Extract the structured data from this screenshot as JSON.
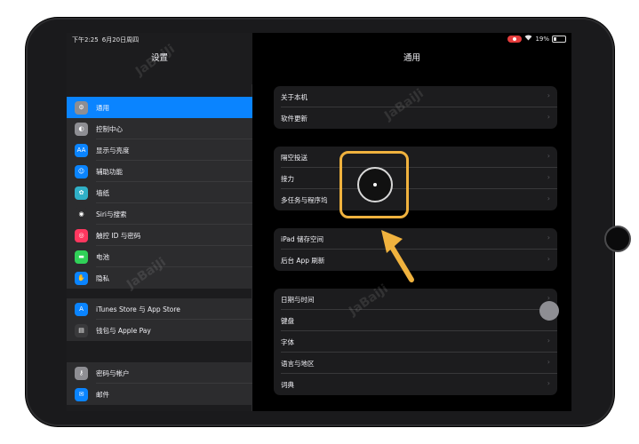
{
  "status_bar": {
    "time": "下午2:25",
    "date": "6月20日周四",
    "battery": "19%"
  },
  "sidebar": {
    "title": "设置",
    "groups": [
      {
        "items": [
          {
            "label": "通用",
            "icon": "gear-icon",
            "color": "#8e8e93",
            "selected": true
          },
          {
            "label": "控制中心",
            "icon": "control-center-icon",
            "color": "#8e8e93"
          },
          {
            "label": "显示与亮度",
            "icon": "display-brightness-icon",
            "color": "#0a84ff"
          },
          {
            "label": "辅助功能",
            "icon": "accessibility-icon",
            "color": "#0a84ff"
          },
          {
            "label": "墙纸",
            "icon": "wallpaper-icon",
            "color": "#30b0c7"
          },
          {
            "label": "Siri与搜索",
            "icon": "siri-icon",
            "color": "#2c2c2e"
          },
          {
            "label": "触控 ID 与密码",
            "icon": "touch-id-icon",
            "color": "#ff375f"
          },
          {
            "label": "电池",
            "icon": "battery-icon",
            "color": "#30d158"
          },
          {
            "label": "隐私",
            "icon": "privacy-hand-icon",
            "color": "#0a84ff"
          }
        ]
      },
      {
        "items": [
          {
            "label": "iTunes Store 与 App Store",
            "icon": "app-store-icon",
            "color": "#0a84ff"
          },
          {
            "label": "钱包与 Apple Pay",
            "icon": "wallet-icon",
            "color": "#3a3a3c"
          }
        ]
      },
      {
        "items": [
          {
            "label": "密码与帐户",
            "icon": "key-icon",
            "color": "#8e8e93"
          },
          {
            "label": "邮件",
            "icon": "mail-icon",
            "color": "#0a84ff"
          }
        ]
      }
    ]
  },
  "detail": {
    "title": "通用",
    "groups": [
      {
        "rows": [
          "关于本机",
          "软件更新"
        ]
      },
      {
        "rows": [
          "隔空投送",
          "接力",
          "多任务与程序坞"
        ]
      },
      {
        "rows": [
          "iPad 储存空间",
          "后台 App 刷新"
        ]
      },
      {
        "rows": [
          "日期与时间",
          "键盘",
          "字体",
          "语言与地区",
          "词典"
        ]
      }
    ]
  },
  "annotation": {
    "highlight_color": "#f0b23e"
  }
}
